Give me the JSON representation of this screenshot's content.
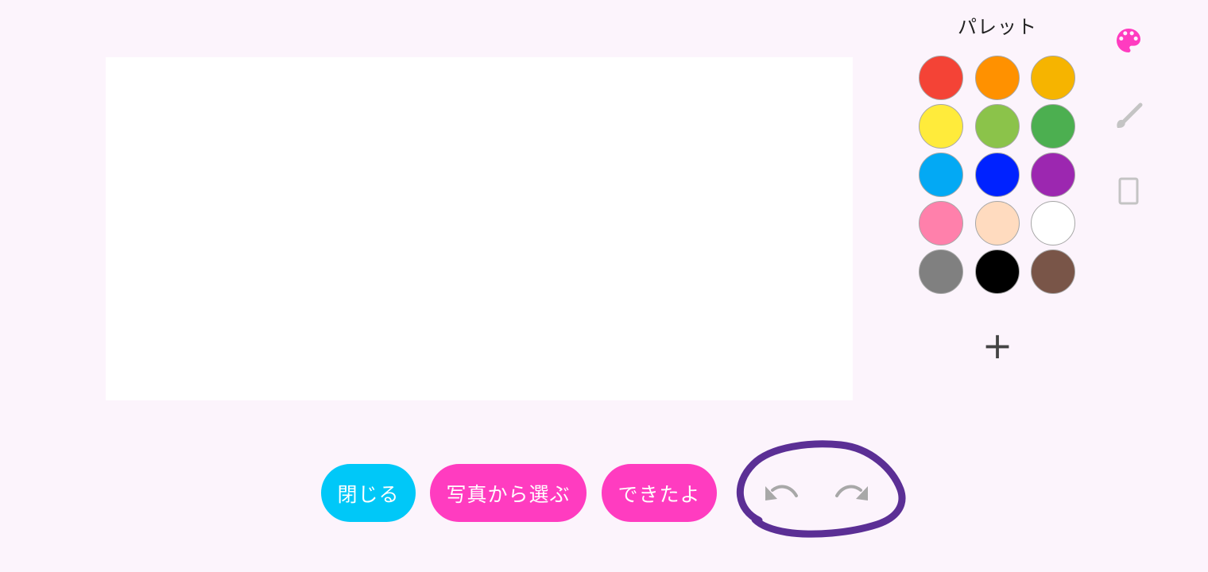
{
  "palette": {
    "title": "パレット",
    "add_label": "+",
    "swatches": [
      {
        "name": "red",
        "color": "#f44336"
      },
      {
        "name": "orange",
        "color": "#ff9100"
      },
      {
        "name": "amber",
        "color": "#f6b400"
      },
      {
        "name": "yellow",
        "color": "#ffeb3b"
      },
      {
        "name": "light-green",
        "color": "#8bc34a"
      },
      {
        "name": "green",
        "color": "#4caf50"
      },
      {
        "name": "light-blue",
        "color": "#03a9f4"
      },
      {
        "name": "blue",
        "color": "#0022ff"
      },
      {
        "name": "purple",
        "color": "#9c27b0"
      },
      {
        "name": "pink",
        "color": "#ff80ab"
      },
      {
        "name": "peach",
        "color": "#ffdbbf"
      },
      {
        "name": "white",
        "color": "#ffffff"
      },
      {
        "name": "gray",
        "color": "#808080"
      },
      {
        "name": "black",
        "color": "#000000"
      },
      {
        "name": "brown",
        "color": "#795548"
      }
    ]
  },
  "side_tools": [
    {
      "name": "palette-icon",
      "active": true,
      "color": "#ff3cc0"
    },
    {
      "name": "brush-icon",
      "active": false,
      "color": "#c4c4c4"
    },
    {
      "name": "eraser-icon",
      "active": false,
      "color": "#c4c4c4"
    }
  ],
  "bottom_bar": {
    "close_label": "閉じる",
    "choose_photo_label": "写真から選ぶ",
    "done_label": "できたよ",
    "close_color": "#00c8f8",
    "action_color": "#ff3cc0",
    "undo_icon": "undo-icon",
    "redo_icon": "redo-icon",
    "undo_redo_color": "#a8a8a8"
  },
  "annotation": {
    "shape": "hand-drawn circle",
    "color": "#5b2f95"
  }
}
